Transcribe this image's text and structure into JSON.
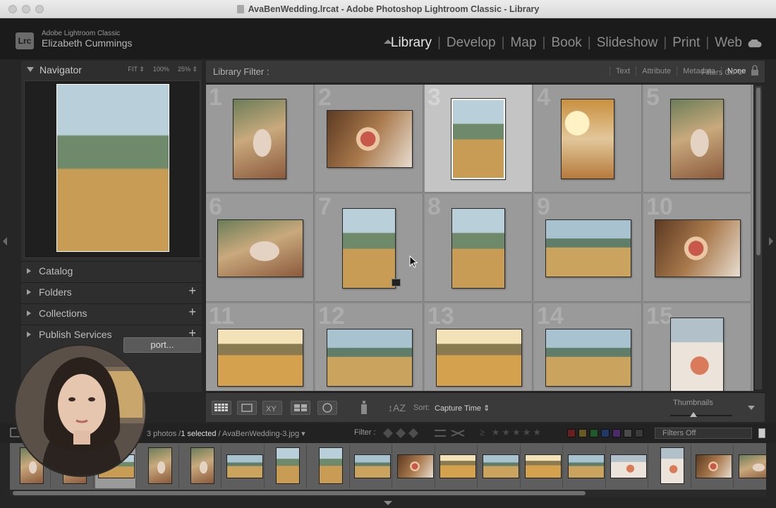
{
  "window": {
    "title": "AvaBenWedding.lrcat - Adobe Photoshop Lightroom Classic - Library"
  },
  "identity": {
    "app_name": "Adobe Lightroom Classic",
    "user_name": "Elizabeth Cummings",
    "logo_text": "Lrc"
  },
  "modules": [
    "Library",
    "Develop",
    "Map",
    "Book",
    "Slideshow",
    "Print",
    "Web"
  ],
  "active_module": "Library",
  "navigator": {
    "title": "Navigator",
    "zoom_options": [
      "FIT ⇕",
      "100%",
      "25% ⇕"
    ]
  },
  "left_panels": [
    {
      "label": "Catalog",
      "has_plus": false
    },
    {
      "label": "Folders",
      "has_plus": true
    },
    {
      "label": "Collections",
      "has_plus": true
    },
    {
      "label": "Publish Services",
      "has_plus": true
    }
  ],
  "export_button": "port...",
  "library_filter": {
    "title": "Library Filter :",
    "options": [
      "Text",
      "Attribute",
      "Metadata",
      "None"
    ],
    "selected": "None",
    "filters_off": "Filters Off ⇕"
  },
  "grid": {
    "cells": [
      {
        "num": "1",
        "photo": "p-couple",
        "orient": "portrait",
        "selected": false,
        "badge": false
      },
      {
        "num": "2",
        "photo": "p-bouquet",
        "orient": "landscape",
        "selected": false,
        "badge": false
      },
      {
        "num": "3",
        "photo": "p-field",
        "orient": "portrait",
        "selected": true,
        "badge": false
      },
      {
        "num": "4",
        "photo": "p-sun",
        "orient": "portrait",
        "selected": false,
        "badge": false
      },
      {
        "num": "5",
        "photo": "p-couple",
        "orient": "portrait",
        "selected": false,
        "badge": false
      },
      {
        "num": "6",
        "photo": "p-couple",
        "orient": "landscape",
        "selected": false,
        "badge": false
      },
      {
        "num": "7",
        "photo": "p-field",
        "orient": "portrait",
        "selected": false,
        "badge": true
      },
      {
        "num": "8",
        "photo": "p-field",
        "orient": "portrait",
        "selected": false,
        "badge": false
      },
      {
        "num": "9",
        "photo": "p-wide",
        "orient": "landscape",
        "selected": false,
        "badge": false
      },
      {
        "num": "10",
        "photo": "p-bouquet",
        "orient": "landscape",
        "selected": false,
        "badge": false
      },
      {
        "num": "11",
        "photo": "p-warm",
        "orient": "landscape",
        "selected": false,
        "badge": false
      },
      {
        "num": "12",
        "photo": "p-wide",
        "orient": "landscape",
        "selected": false,
        "badge": false
      },
      {
        "num": "13",
        "photo": "p-warm",
        "orient": "landscape",
        "selected": false,
        "badge": false
      },
      {
        "num": "14",
        "photo": "p-wide",
        "orient": "landscape",
        "selected": false,
        "badge": false
      },
      {
        "num": "15",
        "photo": "p-lace",
        "orient": "portrait",
        "selected": false,
        "badge": false
      }
    ]
  },
  "toolbar": {
    "sort_label": "Sort:",
    "sort_value": "Capture Time ⇕",
    "thumbnails_label": "Thumbnails",
    "thumbnail_size": 0.37
  },
  "filmstrip_bar": {
    "photo_count": "3 photos /",
    "selected_count": "1 selected",
    "current_file": "/ AvaBenWedding-3.jpg ▾",
    "filter_label": "Filter :",
    "stars": "≥ ★★★★★",
    "color_labels": [
      "#6a1f1f",
      "#6a5a1f",
      "#1f5a2a",
      "#1f3a6a",
      "#4a2a6a",
      "#4a4a4a",
      "#3a3a3a"
    ],
    "filters_off": "Filters Off"
  },
  "filmstrip": {
    "thumbs": [
      "p-couple",
      "p-couple",
      "p-field",
      "p-couple",
      "p-couple",
      "p-wide",
      "p-field",
      "p-field",
      "p-wide",
      "p-bouquet",
      "p-warm",
      "p-wide",
      "p-warm",
      "p-wide",
      "p-lace",
      "p-lace",
      "p-bouquet",
      "p-couple"
    ]
  },
  "colors": {
    "accent": "#e6e6e6",
    "panel": "#2e2e2e",
    "grid_bg": "#8b8b8b",
    "selected_cell": "#c4c4c4"
  }
}
